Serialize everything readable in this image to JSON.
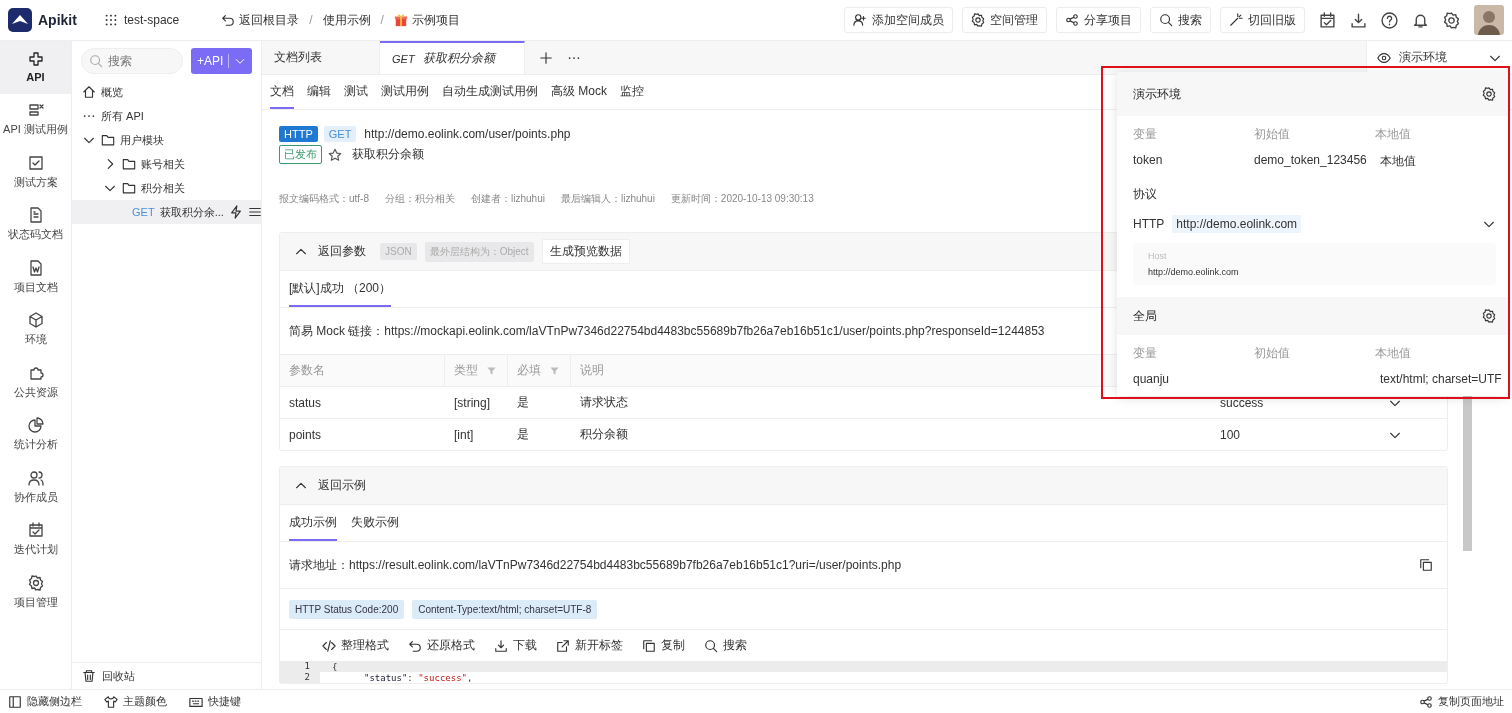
{
  "app": {
    "name": "Apikit",
    "space": "test-space"
  },
  "breadcrumb": [
    {
      "text": "返回根目录",
      "kind": "back"
    },
    {
      "sep": "/",
      "text": "使用示例",
      "kind": "plain"
    },
    {
      "sep": "/",
      "text": "示例项目",
      "kind": "gift"
    }
  ],
  "header_actions": [
    {
      "label": "添加空间成员"
    },
    {
      "label": "空间管理"
    },
    {
      "label": "分享项目"
    },
    {
      "label": "搜索"
    },
    {
      "label": "切回旧版"
    }
  ],
  "rail": [
    {
      "label": "API",
      "selected": true
    },
    {
      "label": "API 测试用例",
      "selected": false
    },
    {
      "label": "测试方案",
      "selected": false
    },
    {
      "label": "状态码文档",
      "selected": false
    },
    {
      "label": "项目文档",
      "selected": false
    },
    {
      "label": "环境",
      "selected": false
    },
    {
      "label": "公共资源",
      "selected": false
    },
    {
      "label": "统计分析",
      "selected": false
    },
    {
      "label": "协作成员",
      "selected": false
    },
    {
      "label": "迭代计划",
      "selected": false
    },
    {
      "label": "项目管理",
      "selected": false
    }
  ],
  "tree": {
    "search": {
      "placeholder": "搜索"
    },
    "add_button": "+API",
    "items": [
      {
        "label": "概览",
        "kind": "home"
      },
      {
        "label": "所有 API",
        "kind": "all"
      },
      {
        "label": "用户模块",
        "kind": "folder",
        "expanded": true,
        "children": [
          {
            "label": "账号相关",
            "kind": "folder",
            "expanded": false
          },
          {
            "label": "积分相关",
            "kind": "folder",
            "expanded": true,
            "children": [
              {
                "label": "获取积分余...",
                "method": "GET",
                "kind": "api",
                "selected": true
              }
            ]
          }
        ]
      }
    ],
    "recycle": "回收站"
  },
  "doc_tabs": [
    {
      "label": "文档列表",
      "selected": false
    },
    {
      "method": "GET",
      "label": "获取积分余额",
      "selected": true
    }
  ],
  "sub_tabs": [
    {
      "label": "文档",
      "selected": true
    },
    {
      "label": "编辑",
      "selected": false
    },
    {
      "label": "测试",
      "selected": false
    },
    {
      "label": "测试用例",
      "selected": false
    },
    {
      "label": "自动生成测试用例",
      "selected": false
    },
    {
      "label": "高级 Mock",
      "selected": false
    },
    {
      "label": "监控",
      "selected": false
    }
  ],
  "api": {
    "protocol": "HTTP",
    "method": "GET",
    "url": "http://demo.eolink.com/user/points.php",
    "status": "已发布",
    "starred": false,
    "name": "获取积分余额",
    "meta": [
      "报文编码格式：utf-8",
      "分组：积分相关",
      "创建者：lizhuhui",
      "最后编辑人：lizhuhui",
      "更新时间：2020-10-13 09:30:13"
    ]
  },
  "return_params": {
    "title": "返回参数",
    "expanded": true,
    "tags": [
      "JSON",
      "最外层结构为：Object"
    ],
    "button": "生成预览数据",
    "tabs": [
      {
        "label": "[默认]成功 （200）",
        "selected": true
      }
    ],
    "mock_label": "简易 Mock 链接：",
    "mock_url": "https://mockapi.eolink.com/laVTnPw7346d22754bd4483bc55689b7fb26a7eb16b51c1/user/points.php?responseId=1244853",
    "columns": [
      {
        "label": "参数名",
        "filter": false
      },
      {
        "label": "类型",
        "filter": true
      },
      {
        "label": "必填",
        "filter": true
      },
      {
        "label": "说明",
        "filter": false
      }
    ],
    "rows": [
      {
        "name": "status",
        "type": "[string]",
        "required": "是",
        "desc": "请求状态",
        "value": "success"
      },
      {
        "name": "points",
        "type": "[int]",
        "required": "是",
        "desc": "积分余额",
        "value": "100"
      }
    ]
  },
  "return_example": {
    "title": "返回示例",
    "expanded": true,
    "tabs": [
      {
        "label": "成功示例",
        "selected": true
      },
      {
        "label": "失败示例",
        "selected": false
      }
    ],
    "address_label": "请求地址：",
    "address": "https://result.eolink.com/laVTnPw7346d22754bd4483bc55689b7fb26a7eb16b51c1?uri=/user/points.php",
    "tags": [
      "HTTP Status Code:200",
      "Content-Type:text/html; charset=UTF-8"
    ],
    "tools": [
      "整理格式",
      "还原格式",
      "下载",
      "新开标签",
      "复制",
      "搜索"
    ],
    "code": [
      {
        "number": "1",
        "tokens": [
          {
            "text": "{",
            "kind": "punct"
          }
        ]
      },
      {
        "number": "2",
        "tokens": [
          {
            "text": "\"status\"",
            "kind": "key"
          },
          {
            "text": ": ",
            "kind": "punct"
          },
          {
            "text": "\"success\"",
            "kind": "string"
          },
          {
            "text": ",",
            "kind": "punct"
          }
        ]
      }
    ]
  },
  "env_select": "演示环境",
  "env_popup": {
    "env": {
      "title": "演示环境",
      "columns": [
        "变量",
        "初始值",
        "本地值"
      ],
      "rows": [
        {
          "name": "token",
          "initial": "demo_token_123456",
          "local": "本地值"
        }
      ]
    },
    "protocol_label": "协议",
    "protocol": "HTTP",
    "protocol_url": "http://demo.eolink.com",
    "host_label": "Host",
    "host": "http://demo.eolink.com",
    "global": {
      "title": "全局",
      "columns": [
        "变量",
        "初始值",
        "本地值"
      ],
      "rows": [
        {
          "name": "quanju",
          "local": "text/html; charset=UTF"
        }
      ]
    }
  },
  "status_bar": {
    "left": [
      "隐藏侧边栏",
      "主题颜色",
      "快捷键"
    ],
    "right": "复制页面地址"
  }
}
